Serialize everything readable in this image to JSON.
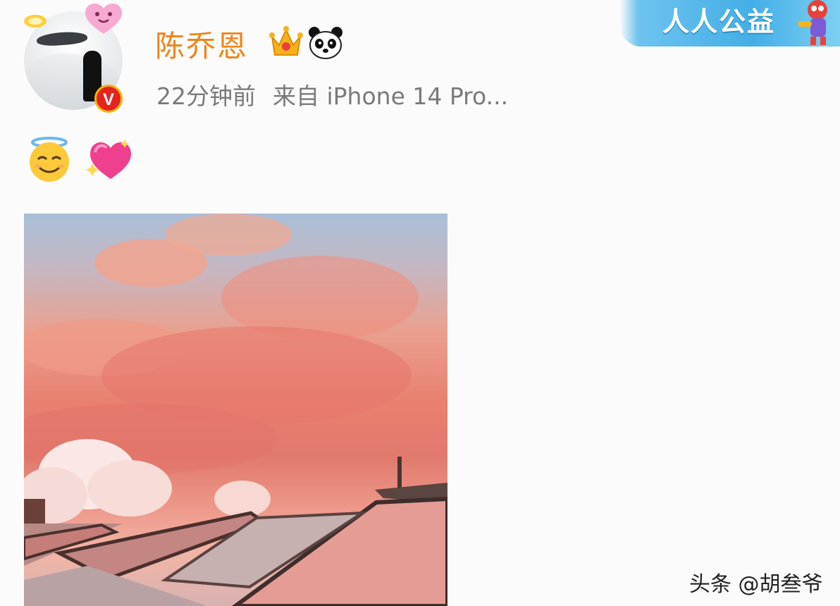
{
  "post": {
    "username": "陈乔恩",
    "time": "22分钟前",
    "source": "来自 iPhone 14 Pro...",
    "content_emojis": [
      "😇",
      "💖"
    ],
    "verified_badge": "V",
    "badges": [
      "crown-icon",
      "panda-icon"
    ],
    "avatar_stickers": [
      "halo-icon",
      "heart-face-icon"
    ]
  },
  "banner": {
    "text": "人人公益"
  },
  "photo": {
    "description_icon": "sunset-photo"
  },
  "watermark": {
    "text": "头条 @胡叁爷"
  },
  "colors": {
    "username": "#f08519",
    "meta": "#7a7a7a",
    "verified": "#e5231f",
    "banner": "#43aee6"
  }
}
